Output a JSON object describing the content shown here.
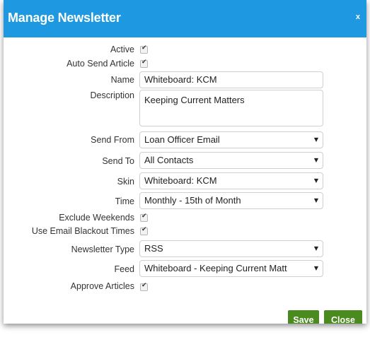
{
  "dialog": {
    "title": "Manage Newsletter",
    "close_glyph": "x"
  },
  "form": {
    "active": {
      "label": "Active",
      "checked": true
    },
    "auto_send_article": {
      "label": "Auto Send Article",
      "checked": true
    },
    "name": {
      "label": "Name",
      "value": "Whiteboard: KCM"
    },
    "description": {
      "label": "Description",
      "value": "Keeping Current Matters"
    },
    "send_from": {
      "label": "Send From",
      "value": "Loan Officer Email"
    },
    "send_to": {
      "label": "Send To",
      "value": "All Contacts"
    },
    "skin": {
      "label": "Skin",
      "value": "Whiteboard: KCM"
    },
    "time": {
      "label": "Time",
      "value": "Monthly - 15th of Month"
    },
    "exclude_weekends": {
      "label": "Exclude Weekends",
      "checked": true
    },
    "use_email_blackout_times": {
      "label": "Use Email Blackout Times",
      "checked": true
    },
    "newsletter_type": {
      "label": "Newsletter Type",
      "value": "RSS"
    },
    "feed": {
      "label": "Feed",
      "value": "Whiteboard - Keeping Current Matt"
    },
    "approve_articles": {
      "label": "Approve Articles",
      "checked": true
    }
  },
  "buttons": {
    "save": "Save",
    "close": "Close"
  },
  "colors": {
    "header": "#1e98e0",
    "button": "#4a8a1f"
  }
}
